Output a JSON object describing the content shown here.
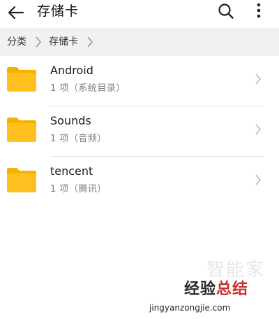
{
  "header": {
    "back_icon": "arrow-left-icon",
    "title": "存储卡",
    "search_icon": "search-icon",
    "more_icon": "more-vertical-icon"
  },
  "breadcrumb": {
    "items": [
      "分类",
      "存储卡"
    ],
    "separator_icon": "chevron-right-icon"
  },
  "files": [
    {
      "name": "Android",
      "meta": "1 项（系统目录）",
      "icon": "folder-icon"
    },
    {
      "name": "Sounds",
      "meta": "1 项（音频）",
      "icon": "folder-icon"
    },
    {
      "name": "tencent",
      "meta": "1 项（腾讯）",
      "icon": "folder-icon"
    }
  ],
  "watermark": {
    "top": "智能家",
    "main_a": "经验",
    "main_b": "总结",
    "url": "jingyanzongjie.com"
  },
  "colors": {
    "folder": "#ffc01f",
    "folder_back": "#f6b000",
    "divider": "#e3e3e3",
    "breadcrumb_bg": "#f1f1f1",
    "watermark_red": "#c9302c"
  }
}
